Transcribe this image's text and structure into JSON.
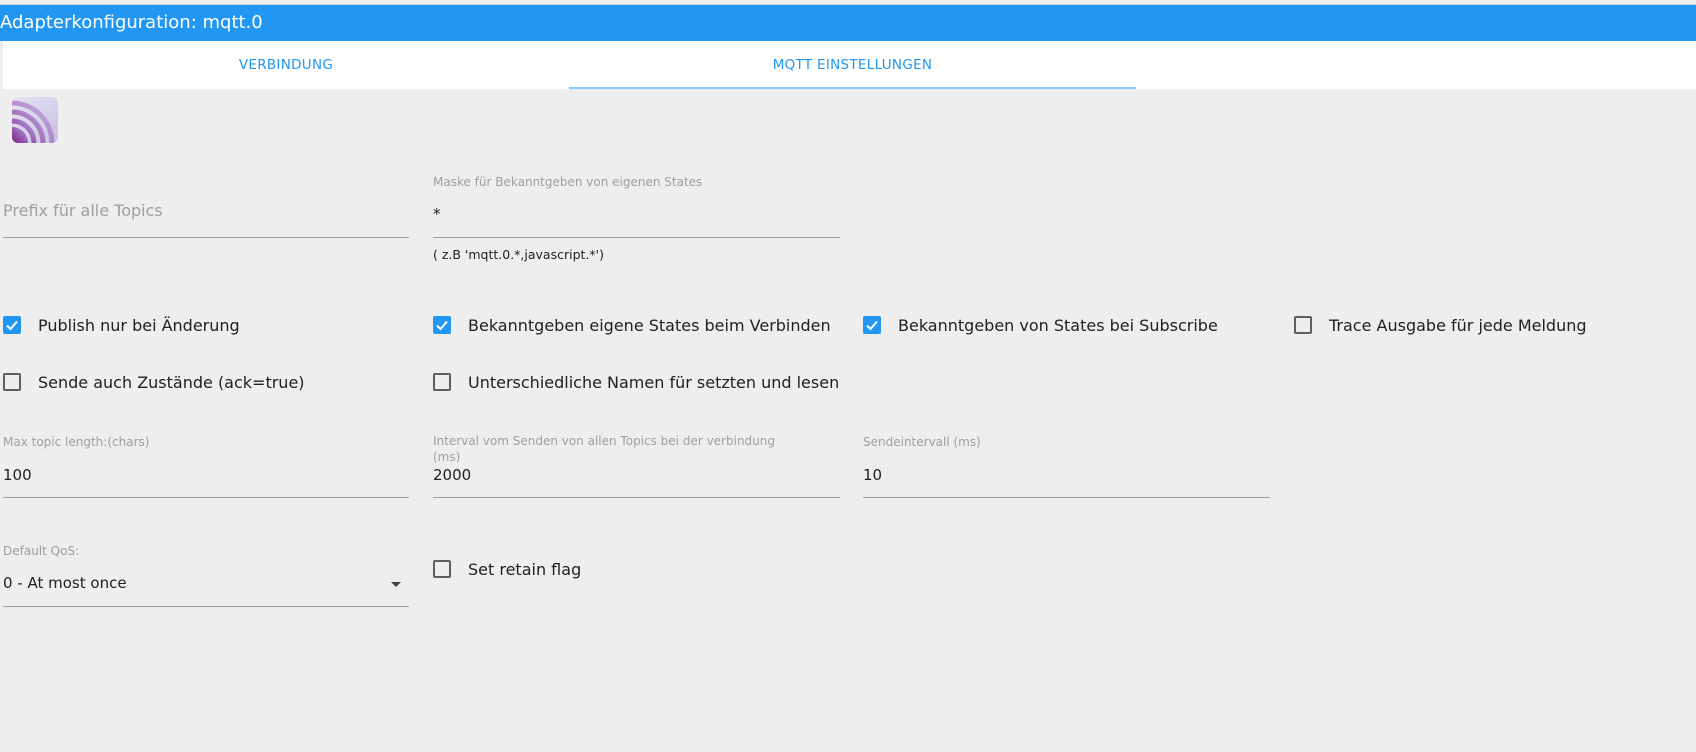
{
  "window": {
    "title": "Adapterkonfiguration: mqtt.0"
  },
  "tabs": [
    {
      "label": "VERBINDUNG",
      "active": false
    },
    {
      "label": "MQTT EINSTELLUNGEN",
      "active": true
    }
  ],
  "logo": {
    "icon": "mqtt-logo-icon"
  },
  "fields": {
    "prefix": {
      "placeholder": "Prefix für alle Topics",
      "value": ""
    },
    "mask": {
      "label": "Maske für Bekanntgeben von eigenen States",
      "value": "*",
      "hint": "( z.B 'mqtt.0.*,javascript.*')"
    },
    "max_topic_length": {
      "label": "Max topic length:(chars)",
      "value": "100"
    },
    "send_interval_all": {
      "label_line1": "Interval vom Senden von allen Topics bei der verbindung",
      "label_line2": "(ms)",
      "value": "2000"
    },
    "send_interval": {
      "label": "Sendeintervall (ms)",
      "value": "10"
    },
    "default_qos": {
      "label": "Default QoS:",
      "value": "0 - At most once"
    }
  },
  "checkboxes": {
    "publish_on_change": {
      "label": "Publish nur bei Änderung",
      "checked": true
    },
    "publish_own_states_on_connect": {
      "label": "Bekanntgeben eigene States beim Verbinden",
      "checked": true
    },
    "publish_states_on_subscribe": {
      "label": "Bekanntgeben von States bei Subscribe",
      "checked": true
    },
    "trace_output": {
      "label": "Trace Ausgabe für jede Meldung",
      "checked": false
    },
    "send_ack_states": {
      "label": "Sende auch Zustände (ack=true)",
      "checked": false
    },
    "different_names": {
      "label": "Unterschiedliche Namen für setzten und lesen",
      "checked": false
    },
    "set_retain_flag": {
      "label": "Set retain flag",
      "checked": false
    }
  },
  "colors": {
    "accent": "#2196f3",
    "background": "#eeeeee",
    "tab_indicator": "#90caf9"
  }
}
